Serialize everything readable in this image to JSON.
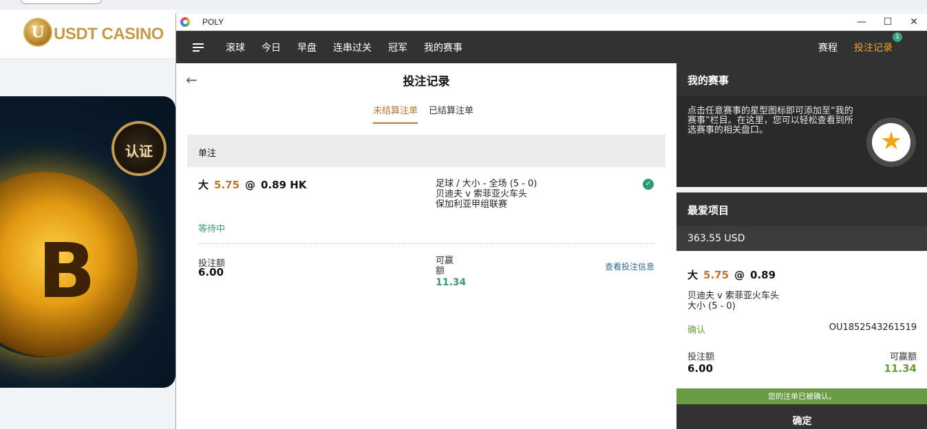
{
  "background": {
    "logo_initial": "U",
    "logo_text": "USDT CASINO",
    "seal_text": "认证",
    "coin_symbol": "B"
  },
  "window": {
    "title": "POLY",
    "controls": {
      "minimize": "—",
      "maximize": "☐",
      "close": "✕"
    }
  },
  "nav": {
    "items": [
      "滚球",
      "今日",
      "早盘",
      "连串过关",
      "冠军",
      "我的赛事"
    ],
    "schedule": "赛程",
    "bet_history": "投注记录",
    "bet_history_count": "1"
  },
  "main": {
    "back": "←",
    "title": "投注记录",
    "tabs": [
      {
        "label": "未结算注单",
        "active": true
      },
      {
        "label": "已结算注单",
        "active": false
      }
    ],
    "section": "单注",
    "bet": {
      "selection": "大",
      "line": "5.75",
      "at": "@",
      "odds": "0.89 HK",
      "sport_market": "足球 / 大小 - 全场 (5 - 0)",
      "match": "贝迪夫 v 索菲亚火车头",
      "league": "保加利亚甲组联赛",
      "status": "等待中",
      "stake_label": "投注额",
      "stake": "6.00",
      "win_label": "可赢额",
      "win": "11.34",
      "view_info": "查看投注信息"
    }
  },
  "right": {
    "my_events_title": "我的赛事",
    "my_events_desc": "点击任意赛事的星型图标即可添加至“我的赛事”栏目。在这里，您可以轻松查看到所选赛事的相关盘口。",
    "favorites_title": "最爱项目",
    "balance": "363.55 USD",
    "slip": {
      "selection": "大",
      "line": "5.75",
      "at": "@",
      "odds": "0.89",
      "match": "贝迪夫 v 索菲亚火车头",
      "market": "大小 (5 - 0)",
      "status": "确认",
      "bet_id": "OU1852543261519",
      "stake_label": "投注额",
      "stake": "6.00",
      "win_label": "可赢额",
      "win": "11.34",
      "confirmed_msg": "您的注单已被确认。",
      "ok": "确定"
    }
  }
}
